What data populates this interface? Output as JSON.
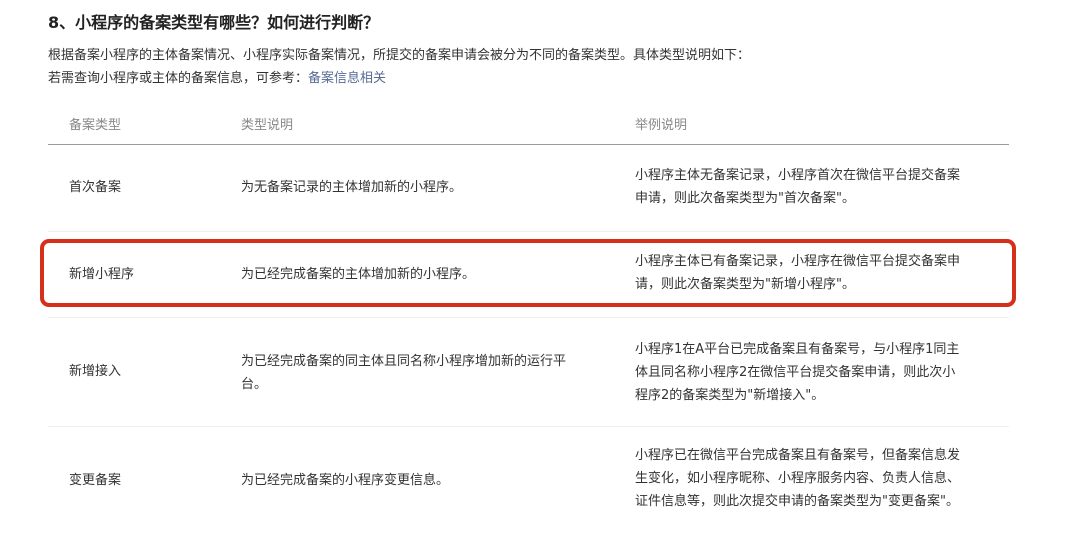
{
  "heading": "8、小程序的备案类型有哪些？如何进行判断？",
  "intro": {
    "line1": "根据备案小程序的主体备案情况、小程序实际备案情况，所提交的备案申请会被分为不同的备案类型。具体类型说明如下：",
    "line2_prefix": "若需查询小程序或主体的备案信息，可参考：",
    "link": "备案信息相关"
  },
  "table": {
    "headers": [
      "备案类型",
      "类型说明",
      "举例说明"
    ],
    "rows": [
      {
        "type": "首次备案",
        "desc": "为无备案记录的主体增加新的小程序。",
        "example": [
          "小程序主体无备案记录，小程序首次在微信平台提交备案",
          "申请，则此次备案类型为\"首次备案\"。"
        ]
      },
      {
        "type": "新增小程序",
        "desc": "为已经完成备案的主体增加新的小程序。",
        "example": [
          "小程序主体已有备案记录，小程序在微信平台提交备案申",
          "请，则此次备案类型为\"新增小程序\"。"
        ]
      },
      {
        "type": "新增接入",
        "desc_lines": [
          "为已经完成备案的同主体且同名称小程序增加新的运行平",
          "台。"
        ],
        "example": [
          "小程序1在A平台已完成备案且有备案号，与小程序1同主",
          "体且同名称小程序2在微信平台提交备案申请，则此次小",
          "程序2的备案类型为\"新增接入\"。"
        ]
      },
      {
        "type": "变更备案",
        "desc": "为已经完成备案的小程序变更信息。",
        "example": [
          "小程序已在微信平台完成备案且有备案号，但备案信息发",
          "生变化，如小程序昵称、小程序服务内容、负责人信息、",
          "证件信息等，则此次提交申请的备案类型为\"变更备案\"。"
        ]
      }
    ]
  },
  "colors": {
    "link": "#576b95",
    "highlight_border": "#d6301c"
  }
}
